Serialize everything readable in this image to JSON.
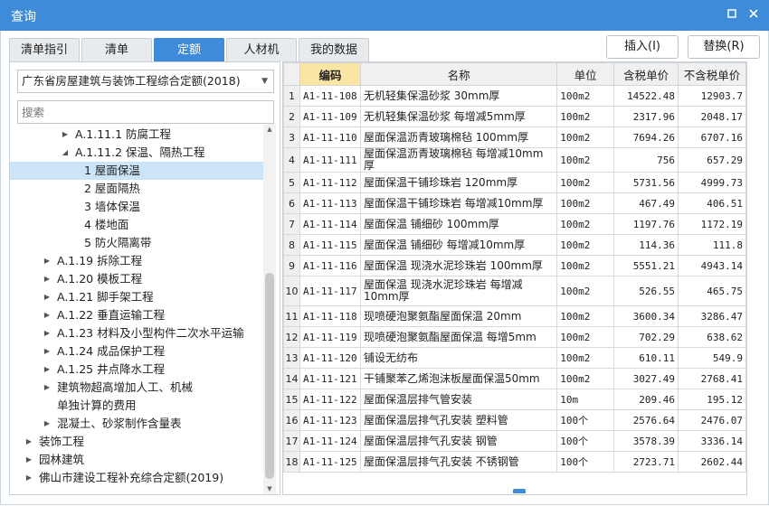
{
  "window": {
    "title": "查询",
    "minimize": "▫",
    "close": "×"
  },
  "tabs": [
    {
      "label": "清单指引",
      "active": false
    },
    {
      "label": "清单",
      "active": false
    },
    {
      "label": "定额",
      "active": true
    },
    {
      "label": "人材机",
      "active": false
    },
    {
      "label": "我的数据",
      "active": false
    }
  ],
  "actions": {
    "insert": "插入(I)",
    "replace": "替换(R)"
  },
  "left": {
    "selector": "广东省房屋建筑与装饰工程综合定额(2018)",
    "search_placeholder": "搜索",
    "tree": [
      {
        "label": "A.1.11.1 防腐工程",
        "caret": "▶",
        "selected": false
      },
      {
        "label": "A.1.11.2 保温、隔热工程",
        "caret": "◢",
        "selected": false
      },
      {
        "label": "1 屋面保温",
        "caret": "",
        "selected": true
      },
      {
        "label": "2 屋面隔热",
        "caret": "",
        "selected": false
      },
      {
        "label": "3 墙体保温",
        "caret": "",
        "selected": false
      },
      {
        "label": "4 楼地面",
        "caret": "",
        "selected": false
      },
      {
        "label": "5 防火隔离带",
        "caret": "",
        "selected": false
      },
      {
        "label": "A.1.19 拆除工程",
        "caret": "▶",
        "selected": false
      },
      {
        "label": "A.1.20 模板工程",
        "caret": "▶",
        "selected": false
      },
      {
        "label": "A.1.21 脚手架工程",
        "caret": "▶",
        "selected": false
      },
      {
        "label": "A.1.22 垂直运输工程",
        "caret": "▶",
        "selected": false
      },
      {
        "label": "A.1.23 材料及小型构件二次水平运输",
        "caret": "▶",
        "selected": false
      },
      {
        "label": "A.1.24 成品保护工程",
        "caret": "▶",
        "selected": false
      },
      {
        "label": "A.1.25 井点降水工程",
        "caret": "▶",
        "selected": false
      },
      {
        "label": "建筑物超高增加人工、机械",
        "caret": "▶",
        "selected": false
      },
      {
        "label": "单独计算的费用",
        "caret": "",
        "selected": false
      },
      {
        "label": "混凝土、砂浆制作含量表",
        "caret": "▶",
        "selected": false
      },
      {
        "label": "装饰工程",
        "caret": "▶",
        "selected": false
      },
      {
        "label": "园林建筑",
        "caret": "▶",
        "selected": false
      },
      {
        "label": "佛山市建设工程补充综合定额(2019)",
        "caret": "▶",
        "selected": false
      }
    ]
  },
  "table": {
    "headers": [
      "",
      "编码",
      "名称",
      "单位",
      "含税单价",
      "不含税单价"
    ],
    "rows": [
      {
        "no": "1",
        "code": "A1-11-108",
        "name": "无机轻集保温砂浆 30mm厚",
        "unit": "100m2",
        "tax": "14522.48",
        "notax": "12903.7"
      },
      {
        "no": "2",
        "code": "A1-11-109",
        "name": "无机轻集保温砂浆 每增减5mm厚",
        "unit": "100m2",
        "tax": "2317.96",
        "notax": "2048.17"
      },
      {
        "no": "3",
        "code": "A1-11-110",
        "name": "屋面保温沥青玻璃棉毡 100mm厚",
        "unit": "100m2",
        "tax": "7694.26",
        "notax": "6707.16"
      },
      {
        "no": "4",
        "code": "A1-11-111",
        "name": "屋面保温沥青玻璃棉毡 每增减10mm厚",
        "unit": "100m2",
        "tax": "756",
        "notax": "657.29"
      },
      {
        "no": "5",
        "code": "A1-11-112",
        "name": "屋面保温干铺珍珠岩 120mm厚",
        "unit": "100m2",
        "tax": "5731.56",
        "notax": "4999.73"
      },
      {
        "no": "6",
        "code": "A1-11-113",
        "name": "屋面保温干铺珍珠岩 每增减10mm厚",
        "unit": "100m2",
        "tax": "467.49",
        "notax": "406.51"
      },
      {
        "no": "7",
        "code": "A1-11-114",
        "name": "屋面保温 铺细砂 100mm厚",
        "unit": "100m2",
        "tax": "1197.76",
        "notax": "1172.19"
      },
      {
        "no": "8",
        "code": "A1-11-115",
        "name": "屋面保温 铺细砂 每增减10mm厚",
        "unit": "100m2",
        "tax": "114.36",
        "notax": "111.8"
      },
      {
        "no": "9",
        "code": "A1-11-116",
        "name": "屋面保温 现浇水泥珍珠岩 100mm厚",
        "unit": "100m2",
        "tax": "5551.21",
        "notax": "4943.14"
      },
      {
        "no": "10",
        "code": "A1-11-117",
        "name": "屋面保温 现浇水泥珍珠岩 每增减10mm厚",
        "unit": "100m2",
        "tax": "526.55",
        "notax": "465.75"
      },
      {
        "no": "11",
        "code": "A1-11-118",
        "name": "现喷硬泡聚氨酯屋面保温 20mm",
        "unit": "100m2",
        "tax": "3600.34",
        "notax": "3286.47"
      },
      {
        "no": "12",
        "code": "A1-11-119",
        "name": "现喷硬泡聚氨酯屋面保温 每增5mm",
        "unit": "100m2",
        "tax": "702.29",
        "notax": "638.62"
      },
      {
        "no": "13",
        "code": "A1-11-120",
        "name": "铺设无纺布",
        "unit": "100m2",
        "tax": "610.11",
        "notax": "549.9"
      },
      {
        "no": "14",
        "code": "A1-11-121",
        "name": "干铺聚苯乙烯泡沫板屋面保温50mm",
        "unit": "100m2",
        "tax": "3027.49",
        "notax": "2768.41"
      },
      {
        "no": "15",
        "code": "A1-11-122",
        "name": "屋面保温层排气管安装",
        "unit": "10m",
        "tax": "209.46",
        "notax": "195.12"
      },
      {
        "no": "16",
        "code": "A1-11-123",
        "name": "屋面保温层排气孔安装 塑料管",
        "unit": "100个",
        "tax": "2576.64",
        "notax": "2476.07"
      },
      {
        "no": "17",
        "code": "A1-11-124",
        "name": "屋面保温层排气孔安装 钢管",
        "unit": "100个",
        "tax": "3578.39",
        "notax": "3336.14"
      },
      {
        "no": "18",
        "code": "A1-11-125",
        "name": "屋面保温层排气孔安装 不锈钢管",
        "unit": "100个",
        "tax": "2723.71",
        "notax": "2602.44"
      }
    ]
  }
}
